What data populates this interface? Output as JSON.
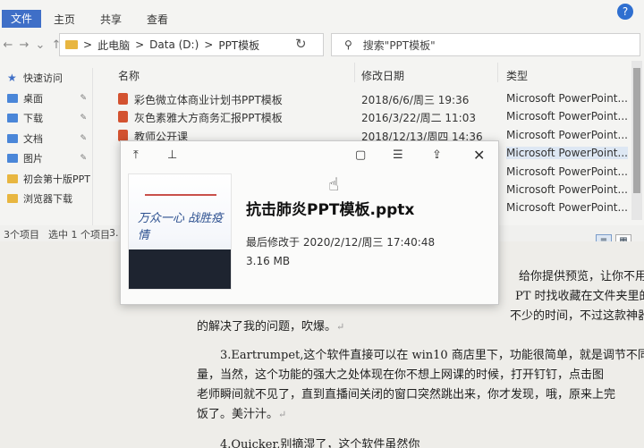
{
  "ribbon": {
    "tabs": [
      "文件",
      "主页",
      "共享",
      "查看"
    ],
    "help": "?"
  },
  "address": {
    "segments": [
      "此电脑",
      "Data (D:)",
      "PPT模板"
    ],
    "separator": ">"
  },
  "search": {
    "placeholder": "搜索\"PPT模板\""
  },
  "sidebar": {
    "items": [
      {
        "label": "快速访问",
        "icon": "star-icon"
      },
      {
        "label": "桌面",
        "icon": "desktop-icon",
        "pinned": true
      },
      {
        "label": "下载",
        "icon": "download-icon",
        "pinned": true
      },
      {
        "label": "文档",
        "icon": "document-icon",
        "pinned": true
      },
      {
        "label": "图片",
        "icon": "image-icon",
        "pinned": true
      },
      {
        "label": "初会第十版PPT",
        "icon": "folder-icon"
      },
      {
        "label": "浏览器下载",
        "icon": "folder-icon"
      }
    ]
  },
  "columns": {
    "name": "名称",
    "date": "修改日期",
    "type": "类型"
  },
  "files": [
    {
      "name": "彩色微立体商业计划书PPT模板",
      "date": "2018/6/6/周三 19:36",
      "type": "Microsoft PowerPoint..."
    },
    {
      "name": "灰色素雅大方商务汇报PPT模板",
      "date": "2016/3/22/周二 11:03",
      "type": "Microsoft PowerPoint..."
    },
    {
      "name": "教师公开课",
      "date": "2018/12/13/周四 14:36",
      "type": "Microsoft PowerPoint..."
    },
    {
      "name": "",
      "date": "",
      "type": "Microsoft PowerPoint..."
    },
    {
      "name": "",
      "date": "",
      "type": "Microsoft PowerPoint..."
    },
    {
      "name": "",
      "date": "",
      "type": "Microsoft PowerPoint..."
    },
    {
      "name": "",
      "date": "",
      "type": "Microsoft PowerPoint..."
    }
  ],
  "status": {
    "count": "3个项目",
    "selected": "选中 1 个项目",
    "size": "3."
  },
  "preview": {
    "filename": "抗击肺炎PPT模板.pptx",
    "modified": "最后修改于 2020/2/12/周三 17:40:48",
    "size": "3.16 MB",
    "thumb_text": "万众一心 战胜疫情"
  },
  "doc": {
    "line1": "给你提供预览，让你不用一",
    "line2": "PT 时找收藏在文件夹里的",
    "line3": "不少的时间，不过这款神器",
    "line4": "的解决了我的问题，吹爆。",
    "line5": "3.Eartrumpet,这个软件直接可以在 win10 商店里下，功能很简单，就是调节不同",
    "line6": "量，当然，这个功能的强大之处体现在你不想上网课的时候，打开钉钉，点击图",
    "line7": "老师瞬间就不见了，直到直播间关闭的窗口突然跳出来，你才发现，哦，原来上完",
    "line8": "饭了。美汁汁。",
    "line9": "4.Quicker,别摘湿了，这个软件虽然你",
    "return_mark": "↵"
  }
}
